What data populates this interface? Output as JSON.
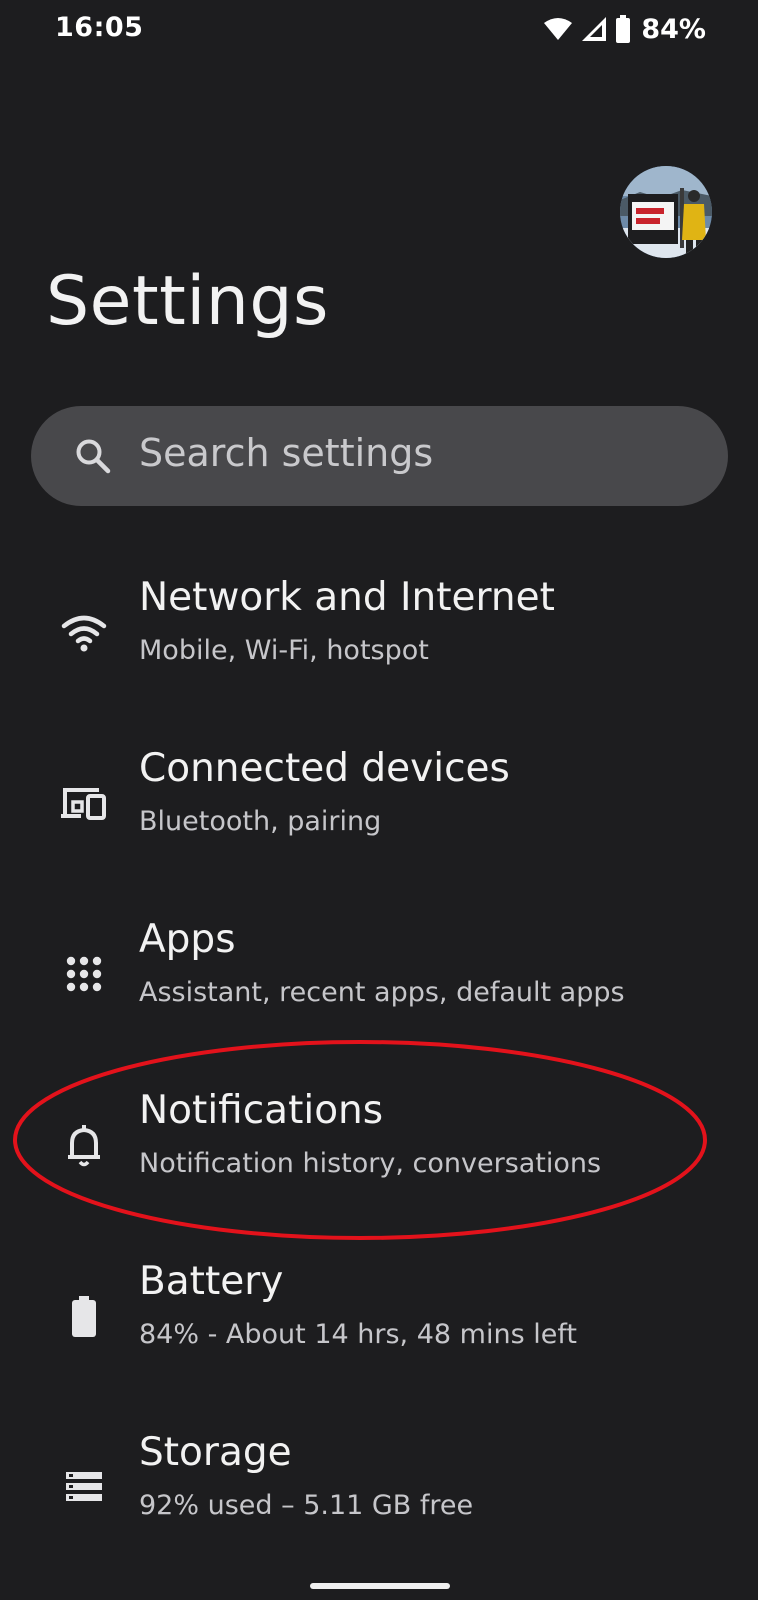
{
  "status_bar": {
    "time": "16:05",
    "battery_percent": "84%",
    "icons": [
      "wifi-icon",
      "cellular-signal-icon",
      "battery-icon"
    ]
  },
  "header": {
    "title": "Settings"
  },
  "search": {
    "placeholder": "Search settings"
  },
  "settings": {
    "items": [
      {
        "title": "Network and Internet",
        "subtitle": "Mobile, Wi-Fi, hotspot",
        "icon": "wifi-icon"
      },
      {
        "title": "Connected devices",
        "subtitle": "Bluetooth, pairing",
        "icon": "connected-devices-icon"
      },
      {
        "title": "Apps",
        "subtitle": "Assistant, recent apps, default apps",
        "icon": "apps-grid-icon"
      },
      {
        "title": "Notifications",
        "subtitle": "Notification history, conversations",
        "icon": "bell-icon"
      },
      {
        "title": "Battery",
        "subtitle": "84% - About 14 hrs, 48 mins left",
        "icon": "battery-icon"
      },
      {
        "title": "Storage",
        "subtitle": "92% used – 5.11 GB free",
        "icon": "storage-icon"
      }
    ]
  },
  "colors": {
    "background": "#1d1d1f",
    "search_bar": "#48484b",
    "highlight": "#e3121b"
  }
}
